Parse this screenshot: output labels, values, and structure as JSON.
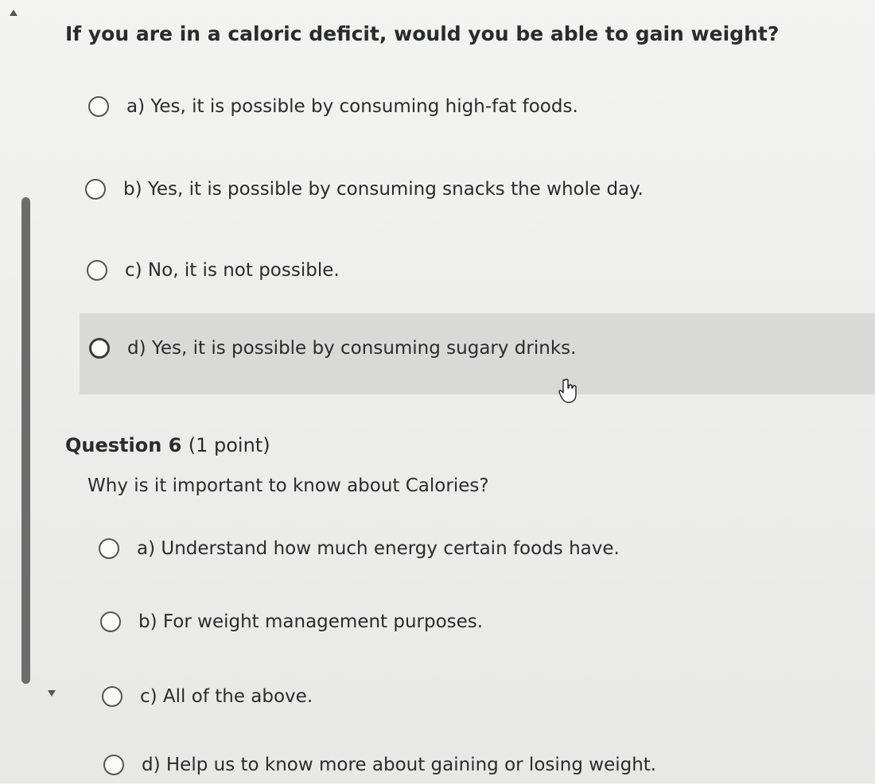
{
  "question5": {
    "prompt": "If you are in a caloric deficit, would you be able to gain weight?",
    "options": [
      {
        "text": "a)  Yes, it is possible by consuming high-fat foods."
      },
      {
        "text": "b)  Yes, it is possible by consuming snacks the whole day."
      },
      {
        "text": "c)  No, it is not possible."
      },
      {
        "text": "d)  Yes, it is possible by consuming sugary drinks."
      }
    ],
    "hovered_option": "d"
  },
  "question6": {
    "heading": "Question 6",
    "points": "(1 point)",
    "prompt": "Why is it important to know about Calories?",
    "options": [
      {
        "text": "a)  Understand how much energy certain foods have."
      },
      {
        "text": "b)  For weight management purposes."
      },
      {
        "text": "c)  All of the above."
      },
      {
        "text": "d)  Help us to know more about gaining or losing weight."
      }
    ]
  },
  "colors": {
    "background": "#efefed",
    "hover_band": "#d9dad8",
    "text": "#2a2b2e",
    "scrollbar": "#6c6c6c"
  },
  "icons": {
    "cursor": "hand-pointer-icon",
    "scroll_up": "triangle-up-icon",
    "scroll_down": "triangle-down-icon"
  }
}
